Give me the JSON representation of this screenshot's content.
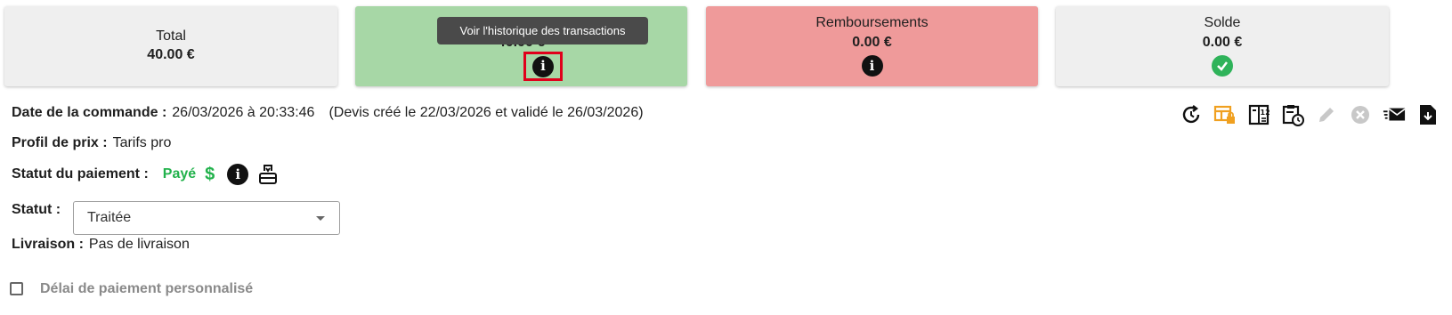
{
  "summary": {
    "total": {
      "title": "Total",
      "value": "40.00 €",
      "color": "#efefef"
    },
    "payments": {
      "value": "40.00 €",
      "color": "#a7d7a6"
    },
    "refunds": {
      "title": "Remboursements",
      "value": "0.00 €",
      "color": "#ef9a9a"
    },
    "balance": {
      "title": "Solde",
      "value": "0.00 €",
      "color": "#efefef"
    }
  },
  "tooltip": {
    "text": "Voir l'historique des transactions"
  },
  "order": {
    "date_label": "Date de la commande :",
    "date_value": "26/03/2026 à 20:33:46",
    "quote_note": "(Devis créé le 22/03/2026 et validé le 26/03/2026)",
    "price_profile_label": "Profil de prix :",
    "price_profile_value": "Tarifs pro",
    "payment_status_label": "Statut du paiement :",
    "payment_status_value": "Payé",
    "status_label": "Statut :",
    "status_value": "Traitée",
    "delivery_label": "Livraison :",
    "delivery_value": "Pas de livraison",
    "custom_payment_delay_label": "Délai de paiement personnalisé",
    "custom_payment_delay_checked": false
  },
  "icons": [
    "history-icon",
    "locked-table-icon",
    "calculator-icon",
    "schedule-icon",
    "edit-icon",
    "cancel-icon",
    "send-email-icon",
    "download-document-icon"
  ],
  "colors": {
    "paid": "#22b24c",
    "accent_orange": "#f0a020",
    "highlight": "#e0001b",
    "disabled": "#c8c8c8"
  }
}
